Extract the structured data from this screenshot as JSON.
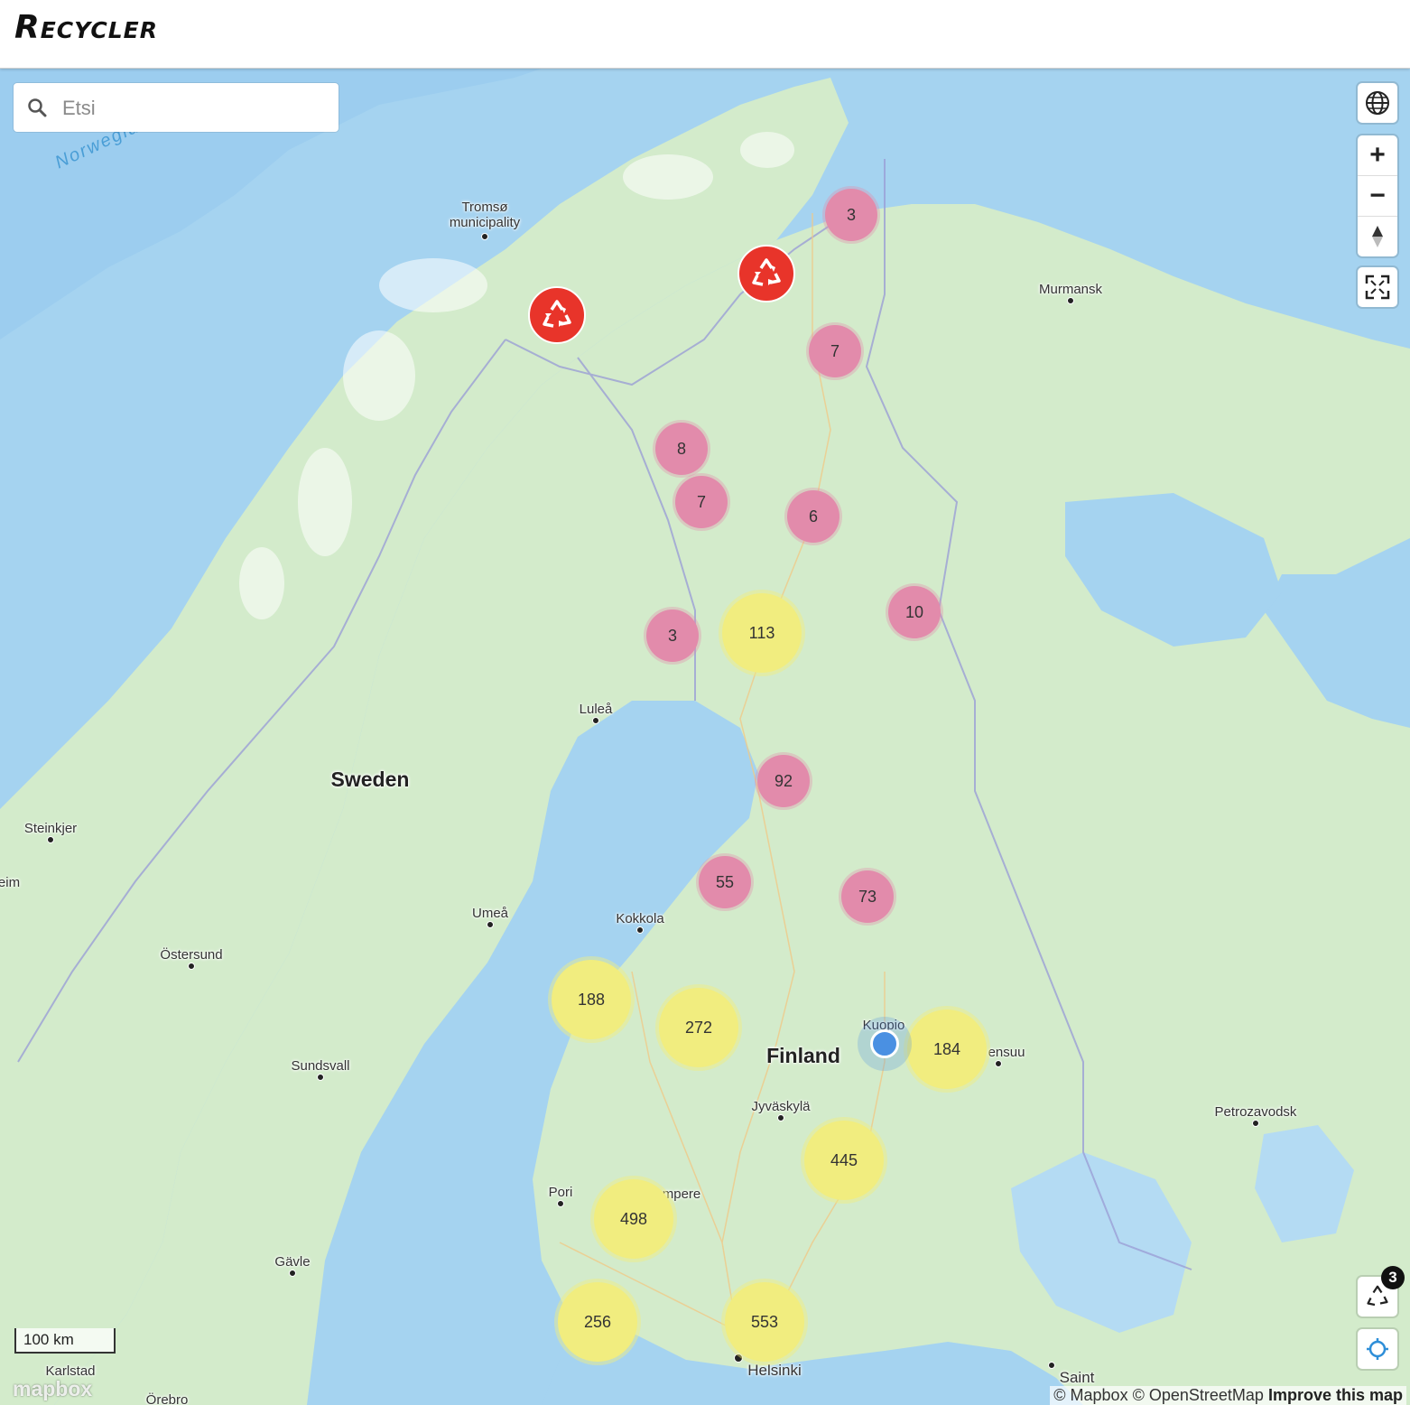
{
  "app": {
    "title": "Recycler"
  },
  "search": {
    "placeholder": "Etsi",
    "value": ""
  },
  "controls": {
    "globe_icon": "globe-icon",
    "zoom_in": "+",
    "zoom_out": "−",
    "compass_icon": "compass-icon",
    "fullscreen_icon": "fullscreen-icon"
  },
  "labels": {
    "sea": "Norwegian Sea",
    "tromso": "Tromsø municipality",
    "murmansk": "Murmansk",
    "lulea": "Luleå",
    "sweden": "Sweden",
    "steinkjer": "Steinkjer",
    "eim": "eim",
    "umea": "Umeå",
    "kokkola": "Kokkola",
    "ostersund": "Östersund",
    "kuopio": "Kuopio",
    "finland": "Finland",
    "joensuu": "ensuu",
    "sundsvall": "Sundsvall",
    "jyvaskyla": "Jyväskylä",
    "petrozavodsk": "Petrozavodsk",
    "pori": "Pori",
    "tampere": "mpere",
    "gavle": "Gävle",
    "karlstad": "Karlstad",
    "orebro": "Örebro",
    "helsinki": "Helsinki",
    "saint": "Saint"
  },
  "clusters": [
    {
      "count": "3",
      "color": "#e28bab"
    },
    {
      "count": "7",
      "color": "#e28bab"
    },
    {
      "count": "8",
      "color": "#e28bab"
    },
    {
      "count": "7",
      "color": "#e28bab"
    },
    {
      "count": "6",
      "color": "#e28bab"
    },
    {
      "count": "10",
      "color": "#e28bab"
    },
    {
      "count": "3",
      "color": "#e28bab"
    },
    {
      "count": "113",
      "color": "#f1ed7f"
    },
    {
      "count": "92",
      "color": "#e28bab"
    },
    {
      "count": "55",
      "color": "#e28bab"
    },
    {
      "count": "73",
      "color": "#e28bab"
    },
    {
      "count": "188",
      "color": "#f1ed7f"
    },
    {
      "count": "272",
      "color": "#f1ed7f"
    },
    {
      "count": "184",
      "color": "#f1ed7f"
    },
    {
      "count": "445",
      "color": "#f1ed7f"
    },
    {
      "count": "498",
      "color": "#f1ed7f"
    },
    {
      "count": "256",
      "color": "#f1ed7f"
    },
    {
      "count": "553",
      "color": "#f1ed7f"
    }
  ],
  "markers": [
    {
      "icon": "recycle-icon"
    },
    {
      "icon": "recycle-icon"
    }
  ],
  "scale": "100 km",
  "attribution": {
    "mapbox": "© Mapbox",
    "osm": "© OpenStreetMap",
    "improve": "Improve this map"
  },
  "logo": "mapbox",
  "recycle_button": {
    "badge": "3"
  },
  "colors": {
    "water": "#a5d3f0",
    "land": "#d3ebcb",
    "cluster_small": "#e28bab",
    "cluster_large": "#f1ed7f",
    "marker": "#e8342a"
  }
}
